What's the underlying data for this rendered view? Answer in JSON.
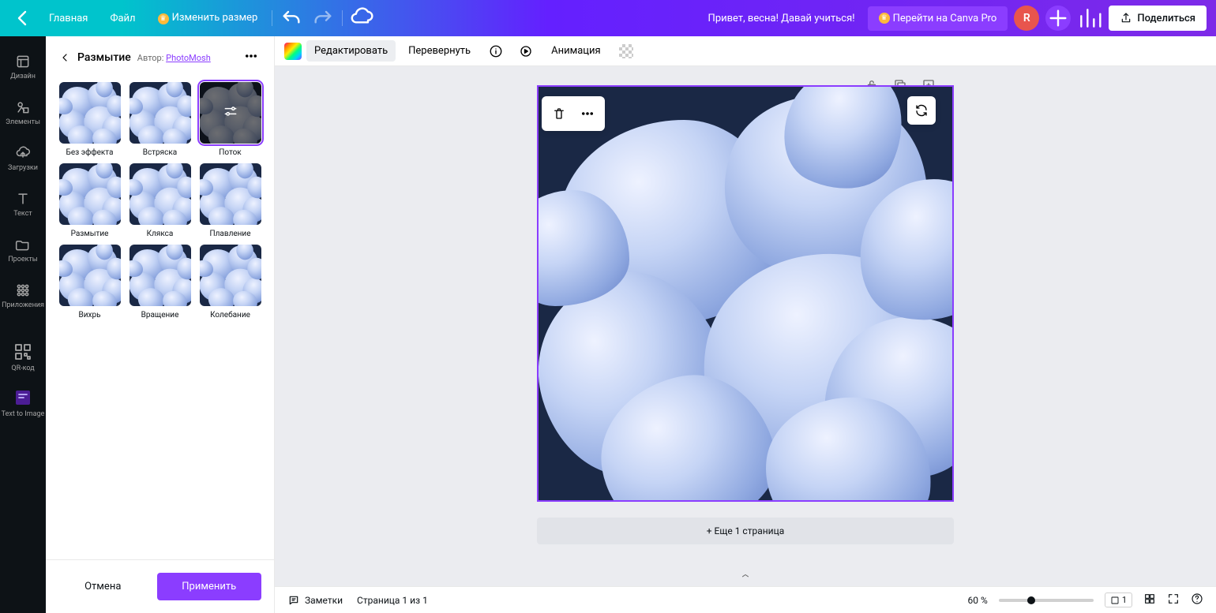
{
  "topbar": {
    "home": "Главная",
    "file": "Файл",
    "resize": "Изменить размер",
    "doc_title": "Привет, весна! Давай учиться!",
    "pro": "Перейти на Canva Pro",
    "avatar": "R",
    "share": "Поделиться"
  },
  "rail": [
    {
      "label": "Дизайн",
      "icon": "design"
    },
    {
      "label": "Элементы",
      "icon": "elements"
    },
    {
      "label": "Загрузки",
      "icon": "uploads"
    },
    {
      "label": "Текст",
      "icon": "text"
    },
    {
      "label": "Проекты",
      "icon": "projects"
    },
    {
      "label": "Приложения",
      "icon": "apps"
    },
    {
      "label": "QR-код",
      "icon": "qr"
    },
    {
      "label": "Text to Image",
      "icon": "tti"
    }
  ],
  "sidepanel": {
    "title": "Размытие",
    "author_label": "Автор:",
    "author_name": "PhotoMosh",
    "effects": [
      {
        "label": "Без эффекта",
        "style": "normal"
      },
      {
        "label": "Встряска",
        "style": "normal"
      },
      {
        "label": "Поток",
        "style": "dark",
        "selected": true
      },
      {
        "label": "Размытие",
        "style": "normal"
      },
      {
        "label": "Клякса",
        "style": "normal"
      },
      {
        "label": "Плавление",
        "style": "normal"
      },
      {
        "label": "Вихрь",
        "style": "normal"
      },
      {
        "label": "Вращение",
        "style": "normal"
      },
      {
        "label": "Колебание",
        "style": "normal"
      }
    ],
    "cancel": "Отмена",
    "apply": "Применить"
  },
  "toolbar": {
    "edit": "Редактировать",
    "flip": "Перевернуть",
    "animation": "Анимация"
  },
  "canvas": {
    "add_page": "+ Еще 1 страница"
  },
  "statusbar": {
    "notes": "Заметки",
    "page_info": "Страница 1 из 1",
    "zoom": "60 %",
    "page_num": "1"
  }
}
